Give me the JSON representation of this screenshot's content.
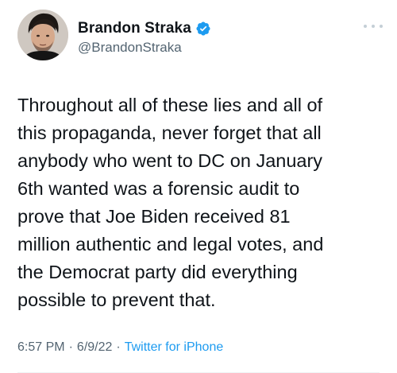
{
  "author": {
    "display_name": "Brandon Straka",
    "handle": "@BrandonStraka",
    "verified_icon": "verified-badge-icon",
    "avatar_icon": "profile-avatar"
  },
  "tweet": {
    "text": "Throughout all of these lies and all of\nthis propaganda, never forget that all\nanybody who went to DC on January\n6th wanted was a forensic audit to\nprove that Joe Biden received 81\nmillion authentic and legal votes, and\nthe Democrat party did everything\npossible to prevent that.",
    "time": "6:57 PM",
    "separator_1": "·",
    "date": "6/9/22",
    "separator_2": "·",
    "source": "Twitter for iPhone"
  },
  "colors": {
    "text": "#0f1419",
    "secondary": "#536471",
    "accent": "#1d9bf0"
  },
  "more_menu_icon": "more-horizontal-icon"
}
